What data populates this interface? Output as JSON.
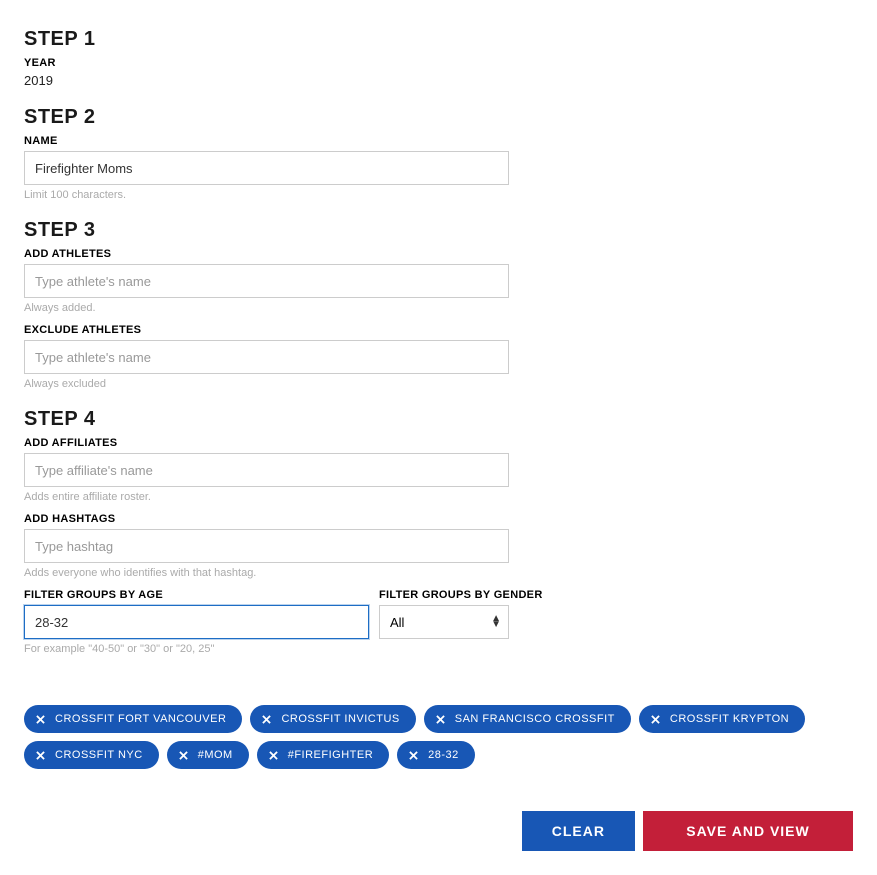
{
  "step1": {
    "heading": "STEP 1",
    "yearLabel": "YEAR",
    "yearValue": "2019"
  },
  "step2": {
    "heading": "STEP 2",
    "nameLabel": "NAME",
    "nameValue": "Firefighter Moms",
    "nameHelper": "Limit 100 characters."
  },
  "step3": {
    "heading": "STEP 3",
    "addAthletesLabel": "ADD ATHLETES",
    "addAthletesPlaceholder": "Type athlete's name",
    "addAthletesHelper": "Always added.",
    "excludeAthletesLabel": "EXCLUDE ATHLETES",
    "excludeAthletesPlaceholder": "Type athlete's name",
    "excludeAthletesHelper": "Always excluded"
  },
  "step4": {
    "heading": "STEP 4",
    "addAffiliatesLabel": "ADD AFFILIATES",
    "addAffiliatesPlaceholder": "Type affiliate's name",
    "addAffiliatesHelper": "Adds entire affiliate roster.",
    "addHashtagsLabel": "ADD HASHTAGS",
    "addHashtagsPlaceholder": "Type hashtag",
    "addHashtagsHelper": "Adds everyone who identifies with that hashtag.",
    "filterAgeLabel": "FILTER GROUPS BY AGE",
    "filterAgeValue": "28-32",
    "filterAgeHelper": "For example \"40-50\" or \"30\" or \"20, 25\"",
    "filterGenderLabel": "FILTER GROUPS BY GENDER",
    "filterGenderValue": "All"
  },
  "chips": [
    "CROSSFIT FORT VANCOUVER",
    "CROSSFIT INVICTUS",
    "SAN FRANCISCO CROSSFIT",
    "CROSSFIT KRYPTON",
    "CROSSFIT NYC",
    "#MOM",
    "#FIREFIGHTER",
    "28-32"
  ],
  "footer": {
    "clearLabel": "CLEAR",
    "saveLabel": "SAVE AND VIEW"
  }
}
